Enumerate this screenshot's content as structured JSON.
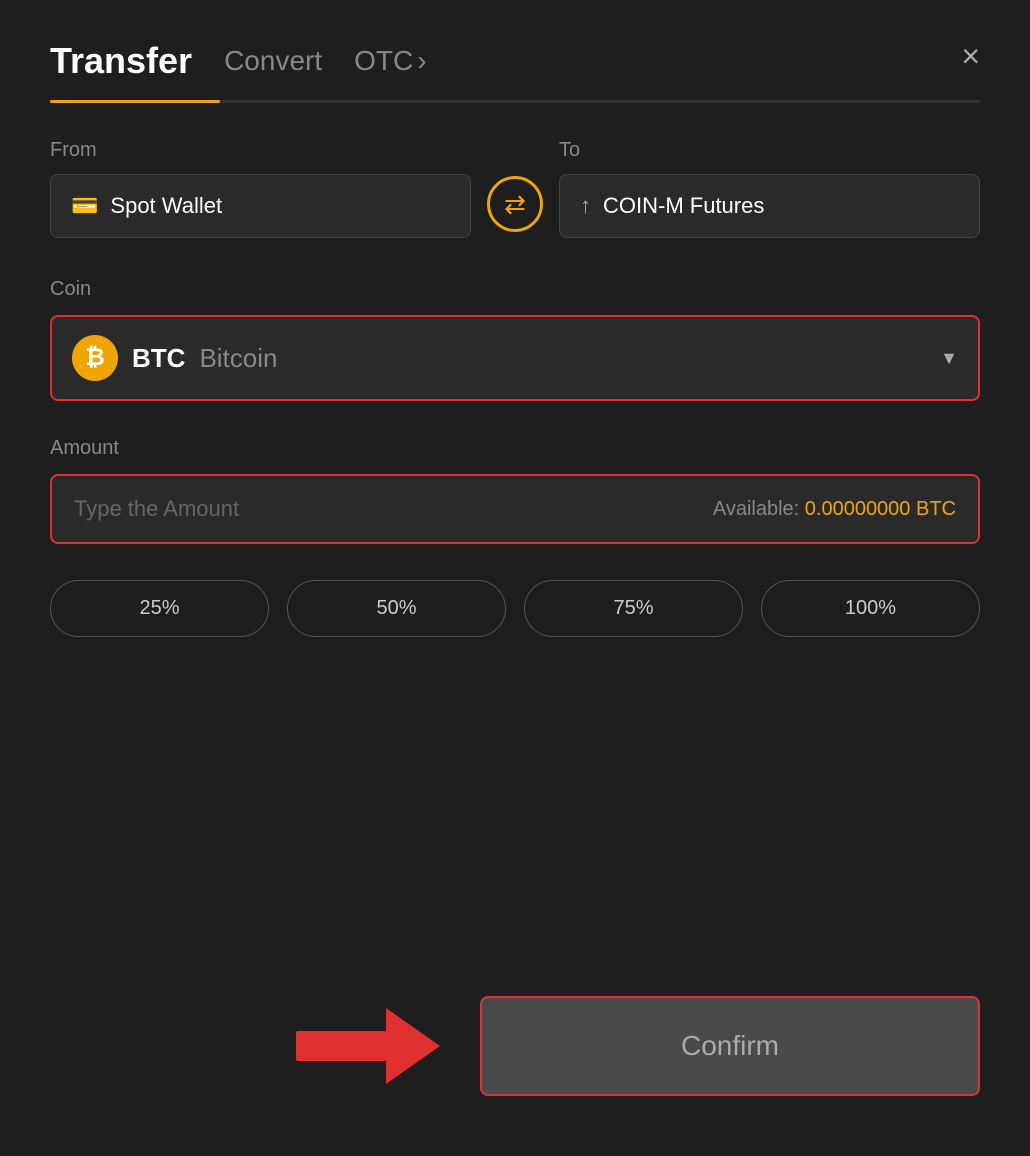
{
  "header": {
    "title": "Transfer",
    "tab_convert": "Convert",
    "tab_otc": "OTC",
    "tab_otc_chevron": "›",
    "close_label": "×"
  },
  "from_to": {
    "from_label": "From",
    "to_label": "To",
    "from_wallet": "Spot Wallet",
    "to_wallet": "COIN-M Futures",
    "swap_icon": "⇄"
  },
  "coin": {
    "label": "Coin",
    "symbol": "BTC",
    "name": "Bitcoin",
    "btc_letter": "₿"
  },
  "amount": {
    "label": "Amount",
    "placeholder": "Type the Amount",
    "available_label": "Available:",
    "available_amount": "0.00000000 BTC"
  },
  "percent_buttons": [
    {
      "label": "25%"
    },
    {
      "label": "50%"
    },
    {
      "label": "75%"
    },
    {
      "label": "100%"
    }
  ],
  "confirm_button": {
    "label": "Confirm"
  },
  "colors": {
    "accent": "#f0a500",
    "danger": "#e03030",
    "bg": "#1e1e1e",
    "card_bg": "#2a2a2a"
  }
}
